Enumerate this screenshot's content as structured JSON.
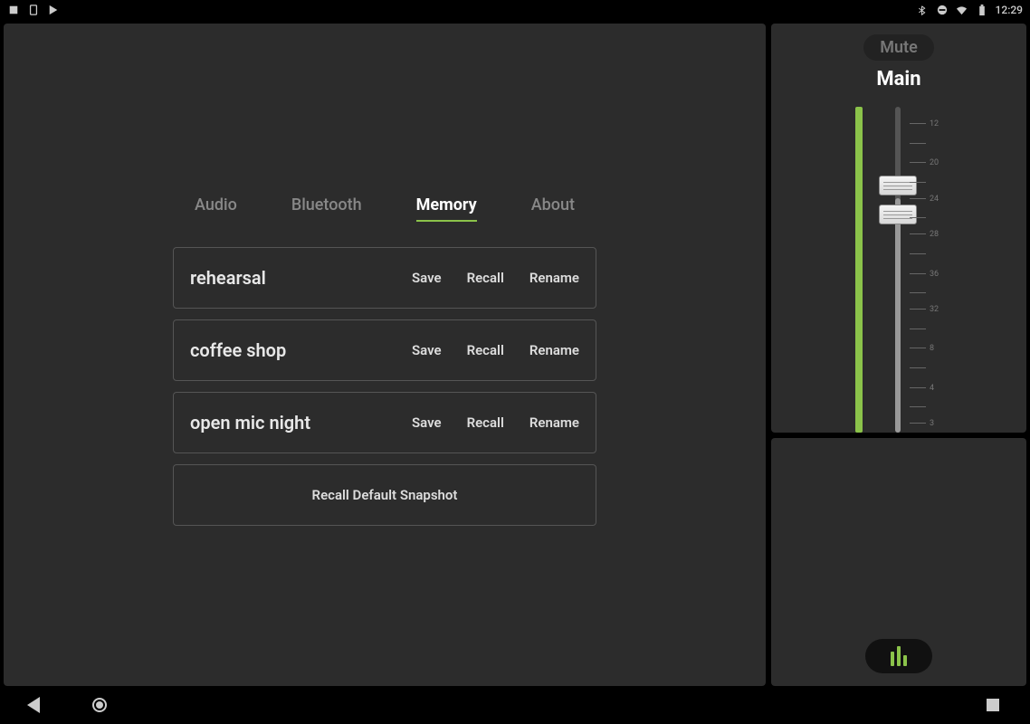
{
  "statusBar": {
    "time": "12:29"
  },
  "tabs": [
    {
      "label": "Audio",
      "active": false
    },
    {
      "label": "Bluetooth",
      "active": false
    },
    {
      "label": "Memory",
      "active": true
    },
    {
      "label": "About",
      "active": false
    }
  ],
  "presets": [
    {
      "name": "rehearsal"
    },
    {
      "name": "coffee shop"
    },
    {
      "name": "open mic night"
    }
  ],
  "presetActions": {
    "save": "Save",
    "recall": "Recall",
    "rename": "Rename"
  },
  "defaultSnapshot": "Recall Default Snapshot",
  "fader": {
    "mute": "Mute",
    "channel": "Main",
    "scaleTicks": [
      "12",
      "",
      "20",
      "",
      "24",
      "",
      "28",
      "",
      "36",
      "",
      "32",
      "",
      "8",
      "",
      "4",
      "",
      "3"
    ]
  }
}
